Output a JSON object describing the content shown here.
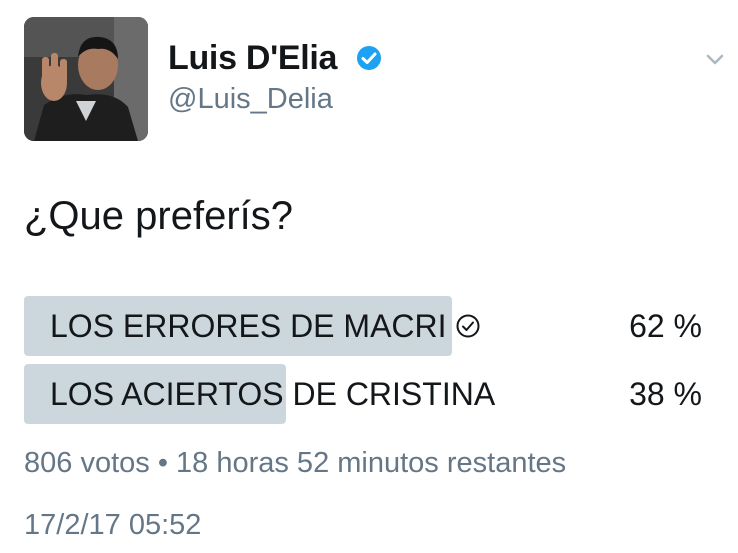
{
  "author": {
    "name": "Luis D'Elia",
    "handle": "@Luis_Delia",
    "verified": true,
    "avatar_icon": "profile-photo"
  },
  "tweet": {
    "text": "¿Que preferís?"
  },
  "poll": {
    "options": [
      {
        "label": "LOS ERRORES DE MACRI",
        "percent_text": "62 %",
        "percent": 62,
        "selected": true
      },
      {
        "label": "LOS ACIERTOS DE CRISTINA",
        "percent_text": "38 %",
        "percent": 38,
        "selected": false
      }
    ],
    "meta": "806 votos • 18 horas 52 minutos restantes"
  },
  "timestamp": "17/2/17 05:52",
  "colors": {
    "text": "#14171a",
    "secondary": "#657786",
    "bar": "#ccd6dd",
    "verified": "#1da1f2"
  },
  "icons": {
    "verified": "verified-badge-icon",
    "caret": "chevron-down-icon",
    "selected": "check-circle-icon"
  }
}
